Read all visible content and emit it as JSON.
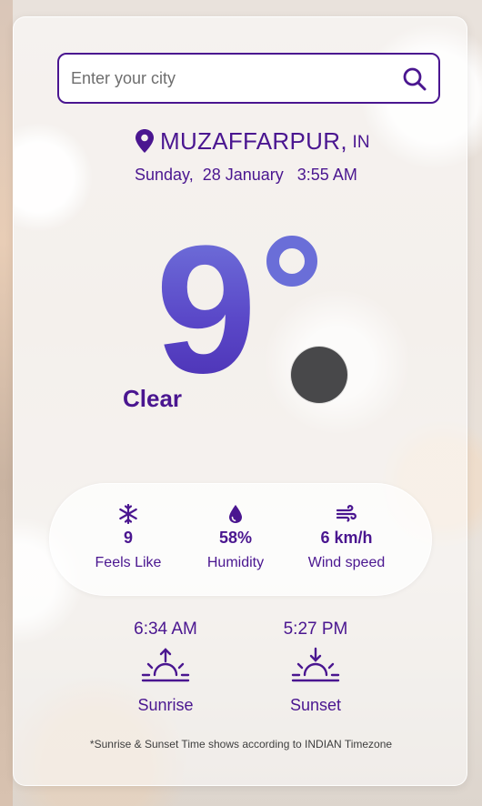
{
  "search": {
    "placeholder": "Enter your city",
    "value": ""
  },
  "location": {
    "city": "MUZAFFARPUR",
    "separator": ",",
    "country": "IN"
  },
  "datetime": {
    "text": "Sunday,  28 January   3:55 AM"
  },
  "current": {
    "temperature": "9",
    "condition": "Clear",
    "weather_icon": "dark-circle-icon"
  },
  "stats": [
    {
      "icon": "snowflake-icon",
      "value": "9",
      "label": "Feels Like"
    },
    {
      "icon": "water-drop-icon",
      "value": "58%",
      "label": "Humidity"
    },
    {
      "icon": "wind-icon",
      "value": "6 km/h",
      "label": "Wind speed"
    }
  ],
  "sun": {
    "sunrise": {
      "time": "6:34 AM",
      "label": "Sunrise"
    },
    "sunset": {
      "time": "5:27 PM",
      "label": "Sunset"
    }
  },
  "note": "*Sunrise & Sunset Time shows according to INDIAN Timezone",
  "colors": {
    "accent": "#4a1690",
    "temperature_gradient_top": "#7276dc",
    "temperature_gradient_bottom": "#4a2eb2"
  }
}
